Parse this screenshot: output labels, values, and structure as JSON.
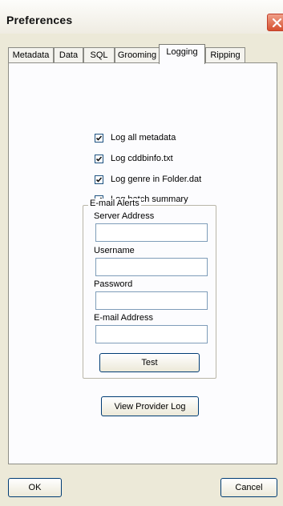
{
  "window": {
    "title": "Preferences"
  },
  "tabs": [
    {
      "label": "Metadata"
    },
    {
      "label": "Data"
    },
    {
      "label": "SQL"
    },
    {
      "label": "Grooming"
    },
    {
      "label": "Logging"
    },
    {
      "label": "Ripping"
    }
  ],
  "active_tab": "Logging",
  "options": [
    {
      "label": "Log all metadata",
      "checked": true
    },
    {
      "label": "Log cddbinfo.txt",
      "checked": true
    },
    {
      "label": "Log genre in Folder.dat",
      "checked": true
    },
    {
      "label": "Log batch summary",
      "checked": true
    }
  ],
  "email_alerts": {
    "title": "E-mail Alerts",
    "server_label": "Server Address",
    "server_value": "",
    "username_label": "Username",
    "username_value": "",
    "password_label": "Password",
    "password_value": "",
    "email_label": "E-mail Address",
    "email_value": "",
    "test_label": "Test"
  },
  "view_log_label": "View Provider Log",
  "footer": {
    "ok_label": "OK",
    "cancel_label": "Cancel"
  },
  "icons": {
    "close": "close-x-icon",
    "check": "checkmark-icon"
  }
}
